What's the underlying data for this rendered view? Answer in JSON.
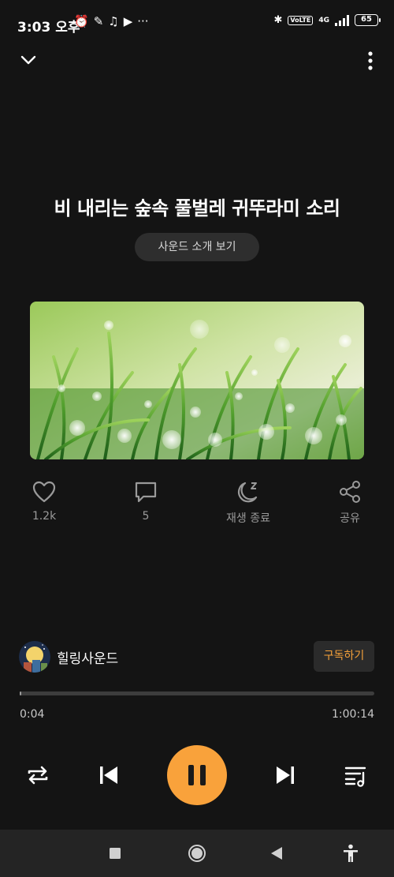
{
  "status_bar": {
    "time": "3:03 오후",
    "volte": "VoLTE",
    "network": "4G",
    "battery": "65"
  },
  "player": {
    "title": "비 내리는 숲속 풀벌레 귀뚜라미 소리",
    "intro_button": "사운드 소개 보기",
    "likes": "1.2k",
    "comments": "5",
    "sleep_timer_label": "재생 종료",
    "share_label": "공유"
  },
  "channel": {
    "name": "힐링사운드",
    "subscribe_label": "구독하기"
  },
  "progress": {
    "current": "0:04",
    "total": "1:00:14",
    "fraction": 0.0011
  },
  "colors": {
    "accent": "#f9a23b",
    "background": "#141414",
    "nav_bar": "#242424"
  },
  "icons": [
    "chevron-down-icon",
    "more-vertical-icon",
    "heart-icon",
    "comment-icon",
    "moon-sleep-icon",
    "share-icon",
    "repeat-icon",
    "skip-previous-icon",
    "pause-icon",
    "skip-next-icon",
    "playlist-icon"
  ]
}
